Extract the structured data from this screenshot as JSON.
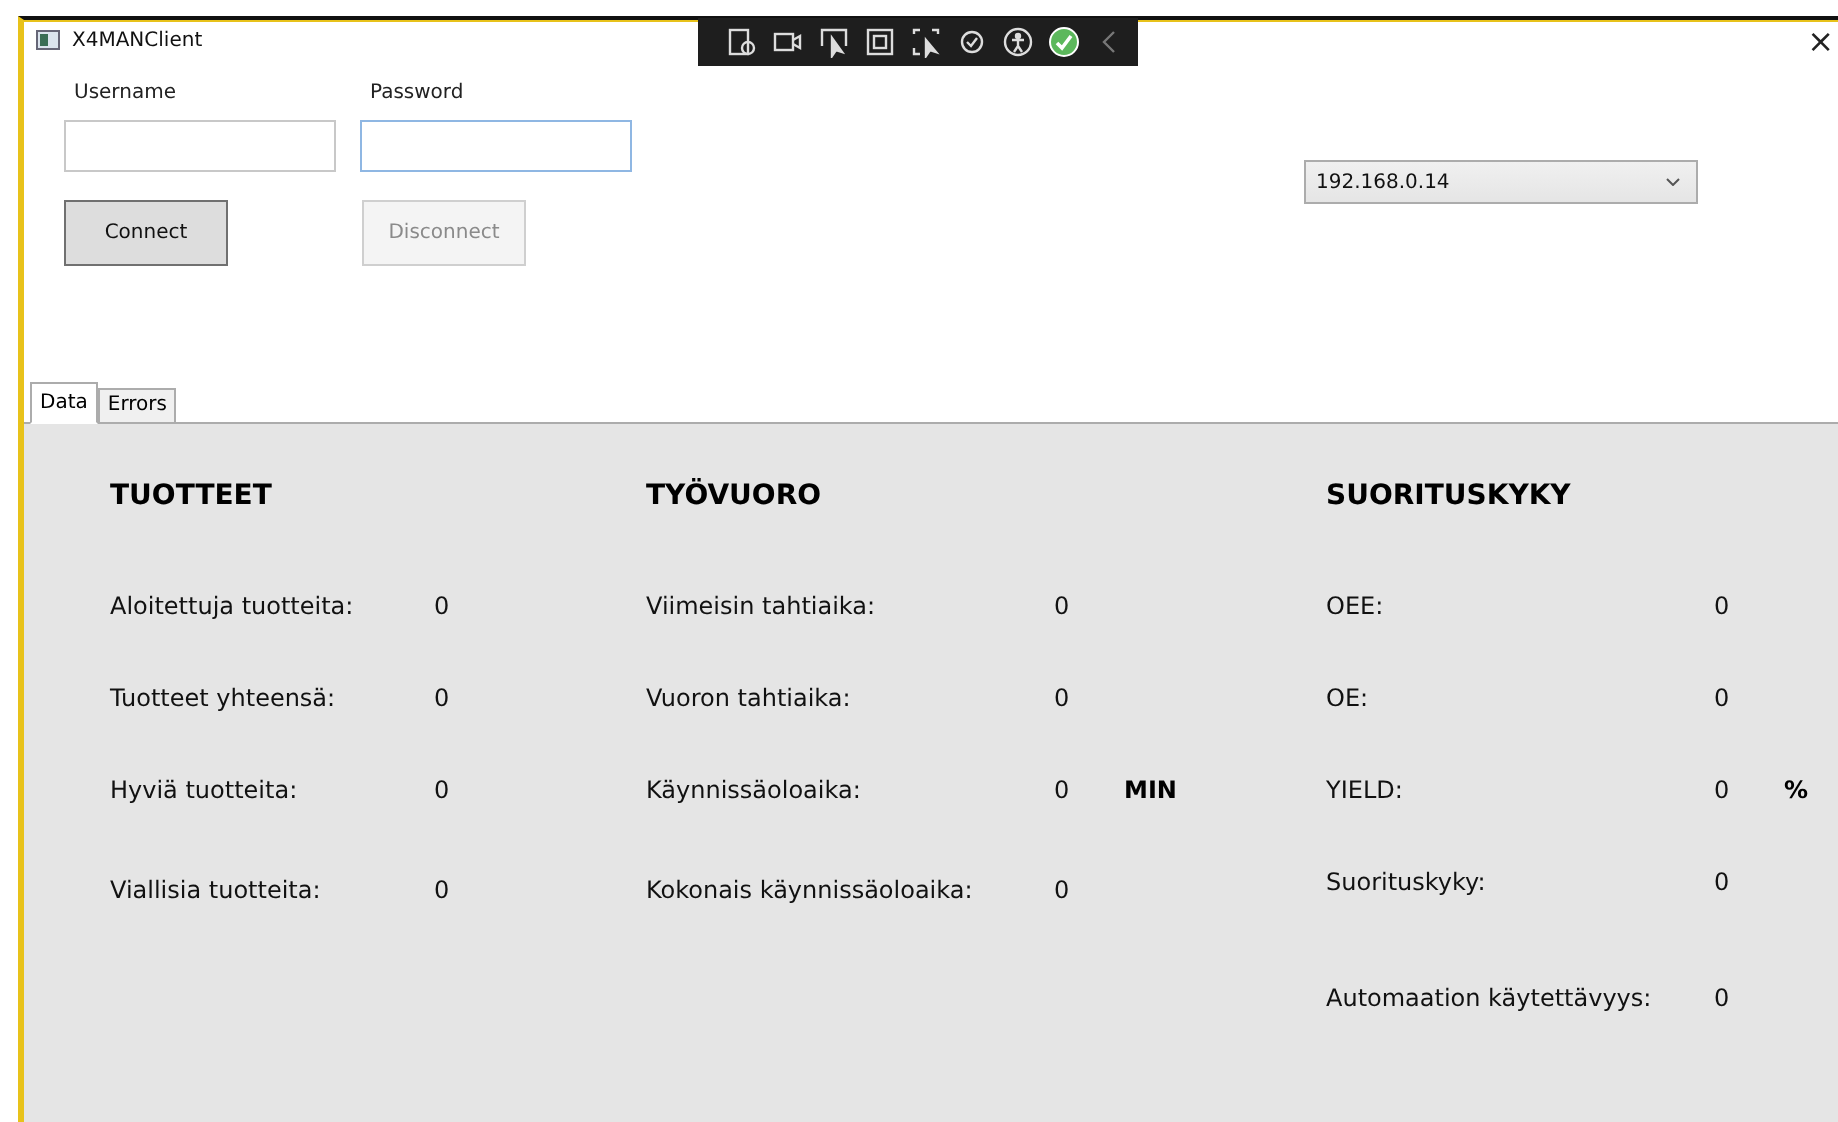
{
  "window": {
    "title": "X4MANClient",
    "close": "×"
  },
  "login": {
    "fields": [
      {
        "label": "Username",
        "focused": false
      },
      {
        "label": "Password",
        "focused": true
      }
    ],
    "buttons": [
      {
        "label": "Connect",
        "disabled": false
      },
      {
        "label": "Disconnect",
        "disabled": true
      }
    ]
  },
  "server_select": {
    "value": "192.168.0.14"
  },
  "tabs": [
    {
      "label": "Data",
      "selected": true
    },
    {
      "label": "Errors",
      "selected": false
    }
  ],
  "sections": [
    {
      "title": "TUOTTEET",
      "rows": [
        {
          "label": "Aloitettuja tuotteita:",
          "value": "0"
        },
        {
          "label": "Tuotteet yhteensä:",
          "value": "0"
        },
        {
          "label": "Hyviä tuotteita:",
          "value": "0"
        },
        {
          "label": "Viallisia tuotteita:",
          "value": "0"
        }
      ]
    },
    {
      "title": "TYÖVUORO",
      "rows": [
        {
          "label": "Viimeisin tahtiaika:",
          "value": "0"
        },
        {
          "label": "Vuoron tahtiaika:",
          "value": "0"
        },
        {
          "label": "Käynnissäoloaika:",
          "value": "0",
          "unit": "MIN"
        },
        {
          "label": "Kokonais käynnissäoloaika:",
          "value": "0"
        }
      ]
    },
    {
      "title": "SUORITUSKYKY",
      "rows": [
        {
          "label": "OEE:",
          "value": "0"
        },
        {
          "label": "OE:",
          "value": "0"
        },
        {
          "label": "YIELD:",
          "value": "0",
          "unit": "%"
        },
        {
          "label": "Suorituskyky:",
          "value": "0"
        },
        {
          "label": "Automaation käytettävyys:",
          "value": "0"
        }
      ]
    }
  ]
}
